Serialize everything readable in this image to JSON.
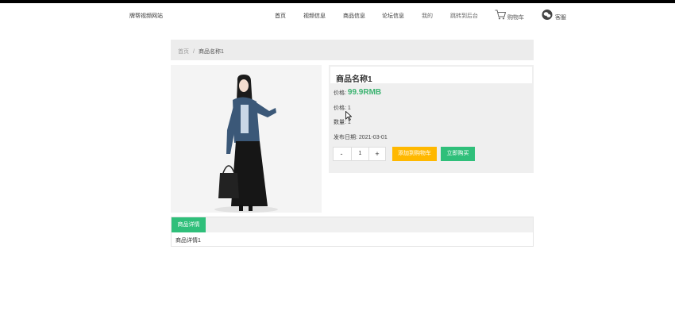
{
  "header": {
    "site_name": "牌帮视频网站",
    "nav": [
      "首页",
      "视频信息",
      "商品信息",
      "论坛信息",
      "我的",
      "跳转到后台"
    ],
    "cart_label": "购物车",
    "service_label": "客服"
  },
  "breadcrumb": {
    "home": "首页",
    "separator": "/",
    "current": "商品名称1"
  },
  "product": {
    "title": "商品名称1",
    "price_label": "价格:",
    "price_value": "99.9RMB",
    "rating_label": "价格:",
    "rating_value": "1",
    "stock_label": "数量:",
    "stock_value": "1",
    "date_label": "发布日期:",
    "date_value": "2021-03-01"
  },
  "quantity": {
    "minus": "-",
    "value": "1",
    "plus": "+"
  },
  "actions": {
    "add_to_cart": "添加到购物车",
    "buy_now": "立即购买"
  },
  "details": {
    "tab_label": "商品详情",
    "content": "商品详情1"
  },
  "colors": {
    "accent_green": "#2fbf7a",
    "price_green": "#3cb371",
    "cart_yellow": "#ffb800"
  }
}
